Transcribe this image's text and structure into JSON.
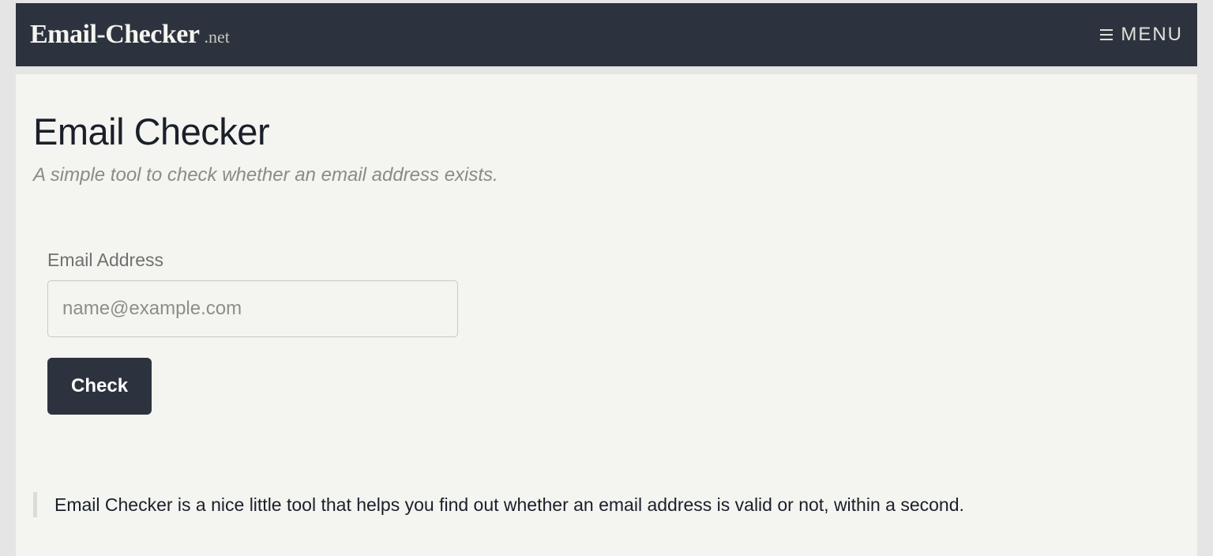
{
  "header": {
    "logo_main": "Email-Checker",
    "logo_suffix": ".net",
    "menu_label": "MENU"
  },
  "main": {
    "title": "Email Checker",
    "subtitle": "A simple tool to check whether an email address exists.",
    "form": {
      "label": "Email Address",
      "placeholder": "name@example.com",
      "value": "",
      "submit_label": "Check"
    },
    "description": "Email Checker is a nice little tool that helps you find out whether an email address is valid or not, within a second."
  }
}
